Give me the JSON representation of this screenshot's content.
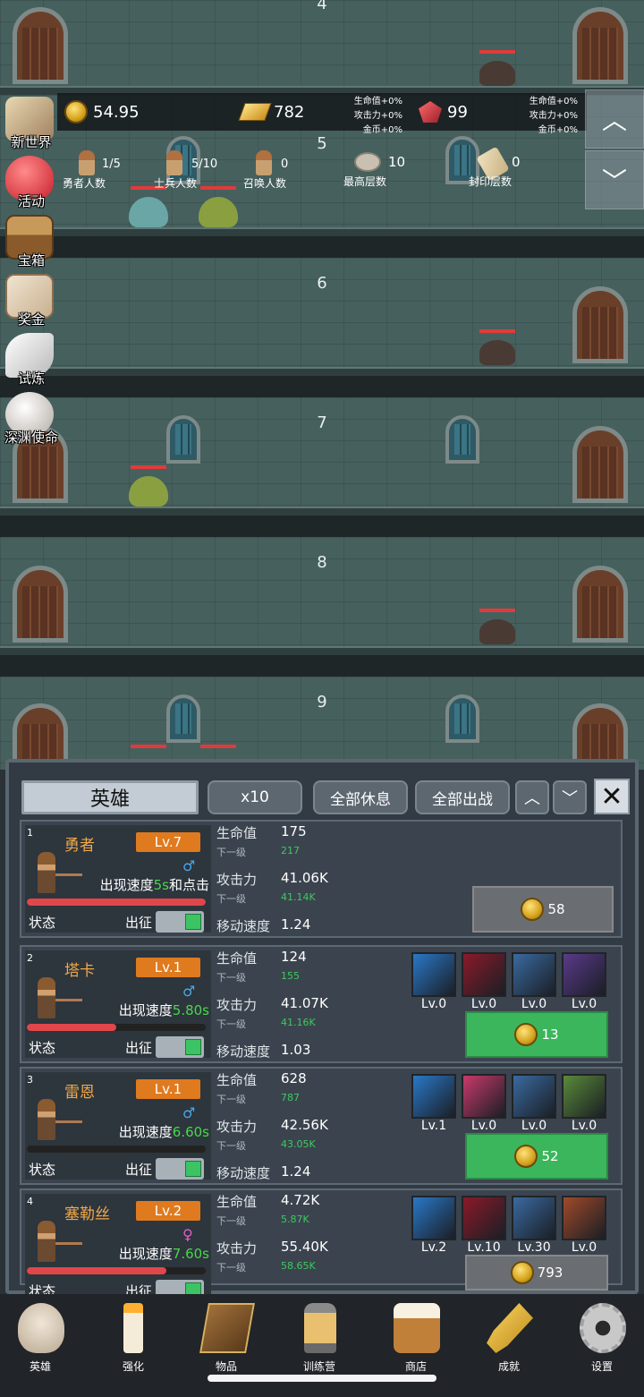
{
  "floors": [
    "4",
    "5",
    "6",
    "7",
    "8",
    "9"
  ],
  "resources": {
    "coins": "54.95",
    "gold": "782",
    "gems": "99",
    "bonus_gold": [
      "生命值+0%",
      "攻击力+0%",
      "金币+0%"
    ],
    "bonus_gem": [
      "生命值+0%",
      "攻击力+0%",
      "金币+0%"
    ]
  },
  "stats": {
    "heroes": {
      "value": "1/5",
      "label": "勇者人数"
    },
    "soldiers": {
      "value": "5/10",
      "label": "士兵人数"
    },
    "summons": {
      "value": "0",
      "label": "召唤人数"
    },
    "highest_floor": {
      "value": "10",
      "label": "最高层数"
    },
    "sealed_floor": {
      "value": "0",
      "label": "封印层数"
    }
  },
  "left_menu": [
    "新世界",
    "活动",
    "宝箱",
    "奖金",
    "试炼",
    "深渊使命"
  ],
  "side_buttons": {
    "up": "︿",
    "down": "﹀"
  },
  "panel": {
    "tab_title": "英雄",
    "multiplier": "x10",
    "rest_all": "全部休息",
    "deploy_all": "全部出战",
    "up": "︿",
    "down": "﹀",
    "close": "✕"
  },
  "labels": {
    "hp": "生命值",
    "next": "下一级",
    "atk": "攻击力",
    "move": "移动速度",
    "status": "状态",
    "deploy": "出征"
  },
  "heroes": [
    {
      "idx": "1",
      "name": "勇者",
      "level": "Lv.7",
      "gender": "♂",
      "speed_prefix": "出现速度",
      "speed_value": "5s",
      "speed_suffix": "和点击",
      "hp": "175",
      "hp_next": "217",
      "atk": "41.06K",
      "atk_next": "41.14K",
      "move": "1.24",
      "hp_ratio": 1.0,
      "upgrade_cost": "58",
      "upgrade_enabled": false,
      "equip": []
    },
    {
      "idx": "2",
      "name": "塔卡",
      "level": "Lv.1",
      "gender": "♂",
      "speed_prefix": "出现速度",
      "speed_value": "5.80s",
      "speed_suffix": "",
      "hp": "124",
      "hp_next": "155",
      "atk": "41.07K",
      "atk_next": "41.16K",
      "move": "1.03",
      "hp_ratio": 0.5,
      "upgrade_cost": "13",
      "upgrade_enabled": true,
      "equip": [
        "Lv.0",
        "Lv.0",
        "Lv.0",
        "Lv.0"
      ]
    },
    {
      "idx": "3",
      "name": "雷恩",
      "level": "Lv.1",
      "gender": "♂",
      "speed_prefix": "出现速度",
      "speed_value": "6.60s",
      "speed_suffix": "",
      "hp": "628",
      "hp_next": "787",
      "atk": "42.56K",
      "atk_next": "43.05K",
      "move": "1.24",
      "hp_ratio": 0.0,
      "upgrade_cost": "52",
      "upgrade_enabled": true,
      "equip": [
        "Lv.1",
        "Lv.0",
        "Lv.0",
        "Lv.0"
      ]
    },
    {
      "idx": "4",
      "name": "塞勒丝",
      "level": "Lv.2",
      "gender": "♀",
      "speed_prefix": "出现速度",
      "speed_value": "7.60s",
      "speed_suffix": "",
      "hp": "4.72K",
      "hp_next": "5.87K",
      "atk": "55.40K",
      "atk_next": "58.65K",
      "move": "",
      "hp_ratio": 0.78,
      "upgrade_cost": "793",
      "upgrade_enabled": false,
      "equip": [
        "Lv.2",
        "Lv.10",
        "Lv.30",
        "Lv.0"
      ]
    }
  ],
  "bottom_nav": [
    "英雄",
    "强化",
    "物品",
    "训练营",
    "商店",
    "成就",
    "设置"
  ],
  "colors": {
    "accent_orange": "#e07a1e",
    "upgrade_green": "#3cb65c",
    "hp_red": "#e0474a",
    "speed_green": "#48d848"
  }
}
